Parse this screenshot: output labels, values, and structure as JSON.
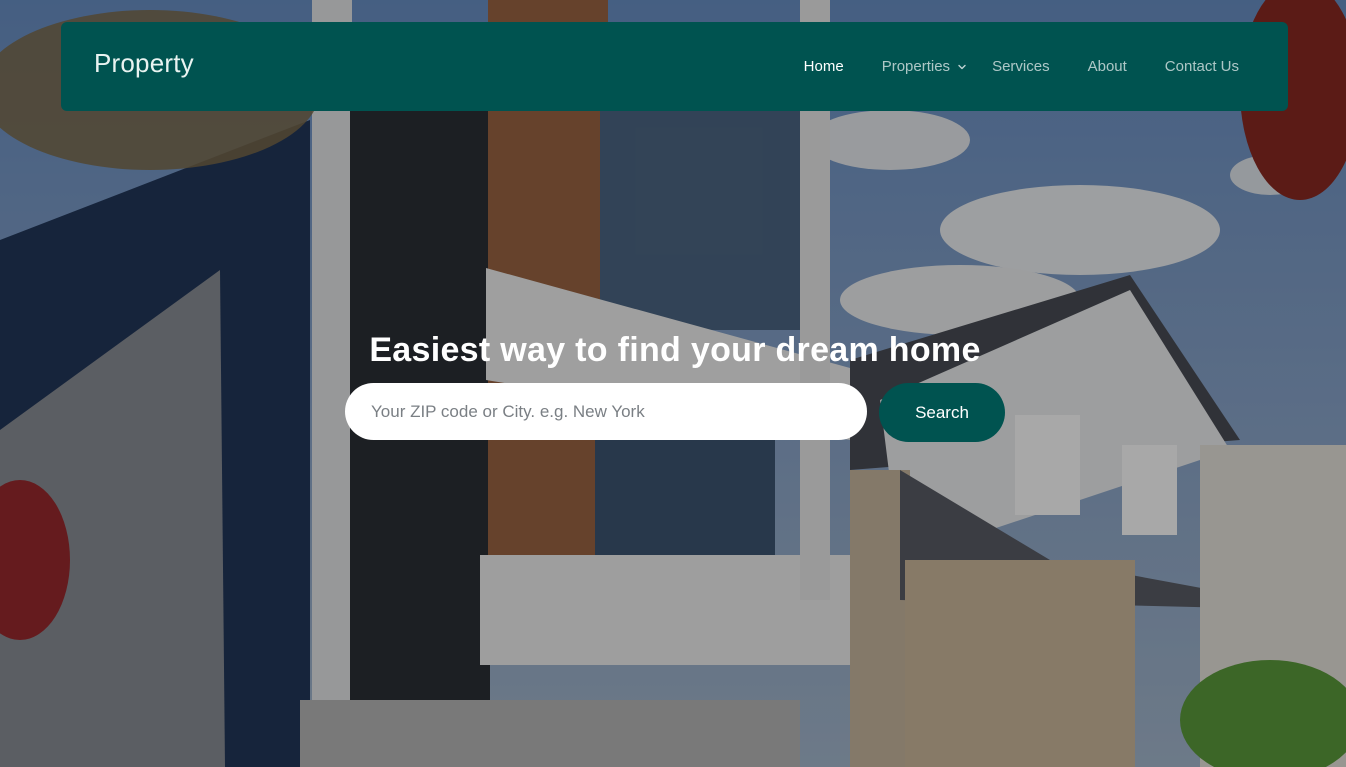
{
  "navbar": {
    "brand": "Property",
    "items": [
      {
        "label": "Home",
        "active": true
      },
      {
        "label": "Properties",
        "dropdown": true
      },
      {
        "label": "Services"
      },
      {
        "label": "About"
      },
      {
        "label": "Contact Us"
      }
    ],
    "background": "#005350"
  },
  "hero": {
    "title": "Easiest way to find your dream home",
    "search": {
      "placeholder": "Your ZIP code or City. e.g. New York",
      "value": "",
      "button_label": "Search"
    },
    "background_image": "modern-house-street-photo"
  },
  "colors": {
    "accent": "#005350",
    "nav_text": "#cfe3e0",
    "active_text": "#ffffff"
  },
  "icons": {
    "dropdown": "chevron-down-icon"
  }
}
